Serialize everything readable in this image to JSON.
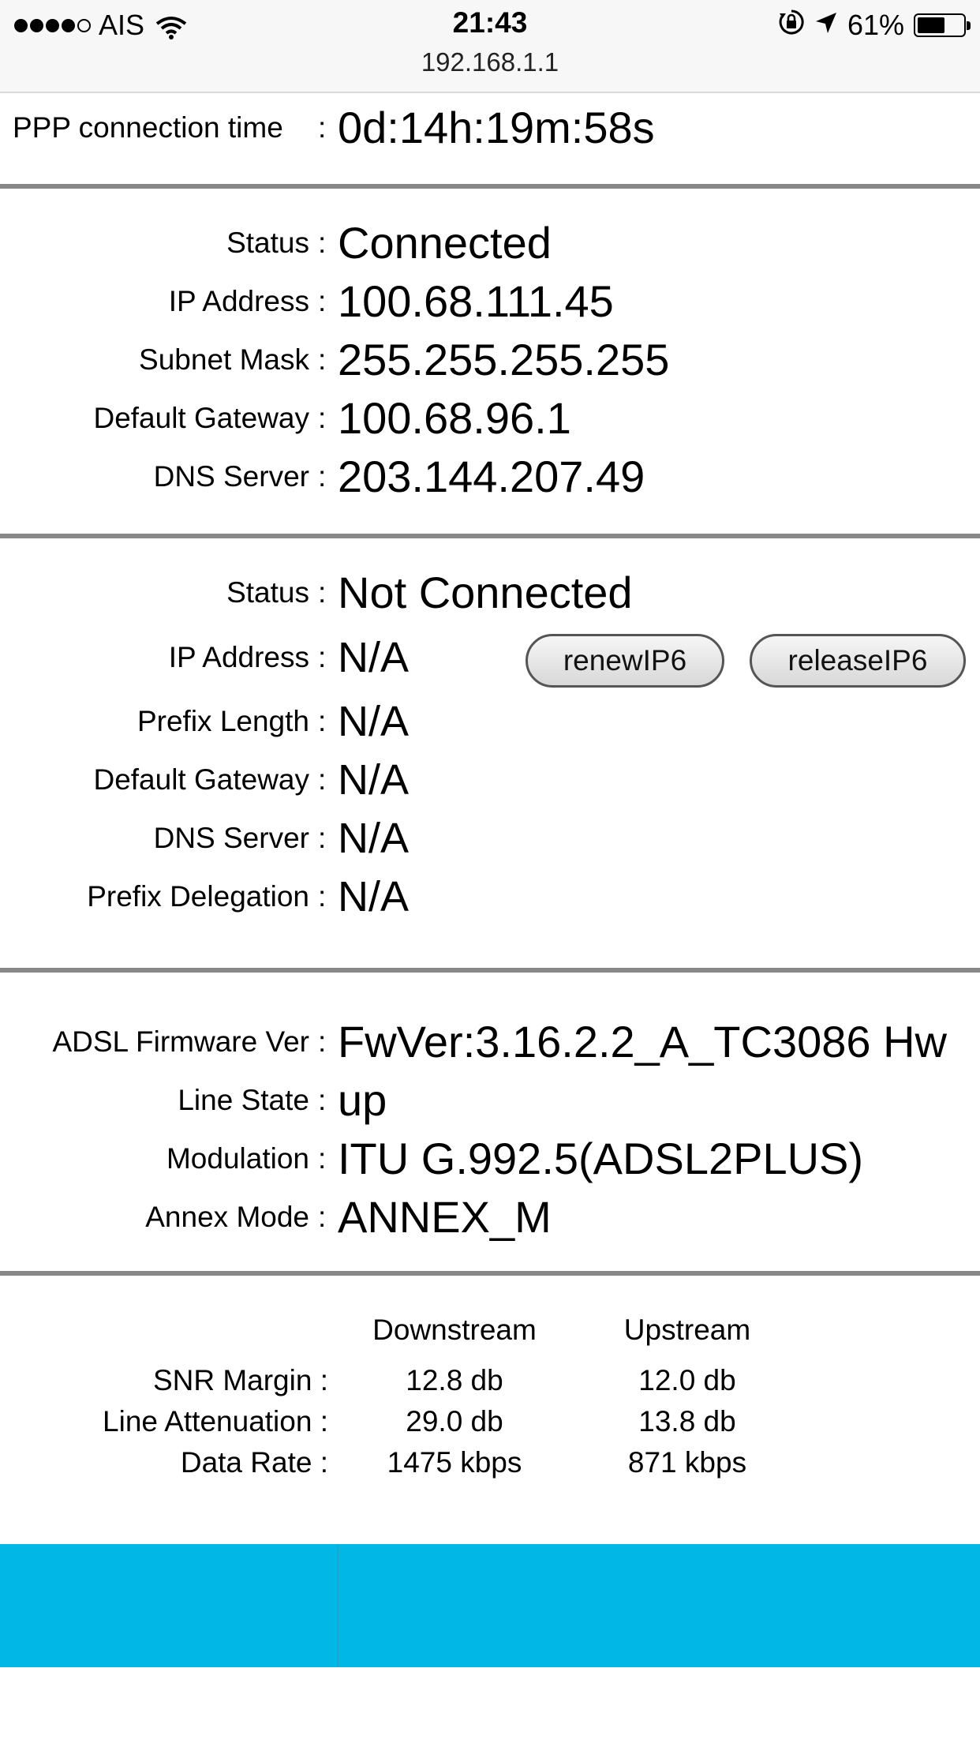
{
  "status_bar": {
    "carrier": "AIS",
    "time": "21:43",
    "url": "192.168.1.1",
    "battery": "61%",
    "battery_level": 0.61
  },
  "ppp": {
    "label": "PPP connection time",
    "value": "0d:14h:19m:58s"
  },
  "ipv4": {
    "rows": [
      {
        "label": "Status",
        "value": "Connected"
      },
      {
        "label": "IP Address",
        "value": "100.68.111.45"
      },
      {
        "label": "Subnet Mask",
        "value": "255.255.255.255"
      },
      {
        "label": "Default Gateway",
        "value": "100.68.96.1"
      },
      {
        "label": "DNS Server",
        "value": "203.144.207.49"
      }
    ]
  },
  "ipv6": {
    "rows": [
      {
        "label": "Status",
        "value": "Not Connected"
      },
      {
        "label": "IP Address",
        "value": "N/A"
      },
      {
        "label": "Prefix Length",
        "value": "N/A"
      },
      {
        "label": "Default Gateway",
        "value": "N/A"
      },
      {
        "label": "DNS Server",
        "value": "N/A"
      },
      {
        "label": "Prefix Delegation",
        "value": "N/A"
      }
    ],
    "renew_button": "renewIP6",
    "release_button": "releaseIP6"
  },
  "adsl": {
    "rows": [
      {
        "label": "ADSL Firmware Ver",
        "value": "FwVer:3.16.2.2_A_TC3086 Hw"
      },
      {
        "label": "Line State",
        "value": "up"
      },
      {
        "label": "Modulation",
        "value": "ITU G.992.5(ADSL2PLUS)"
      },
      {
        "label": "Annex Mode",
        "value": "ANNEX_M"
      }
    ]
  },
  "line_stats": {
    "headers": [
      "Downstream",
      "Upstream"
    ],
    "rows": [
      {
        "label": "SNR Margin :",
        "downstream": "12.8 db",
        "upstream": "12.0 db"
      },
      {
        "label": "Line Attenuation :",
        "downstream": "29.0 db",
        "upstream": "13.8 db"
      },
      {
        "label": "Data Rate :",
        "downstream": "1475 kbps",
        "upstream": "871 kbps"
      }
    ]
  },
  "colors": {
    "footer": "#00b7e6",
    "divider": "#888888"
  }
}
